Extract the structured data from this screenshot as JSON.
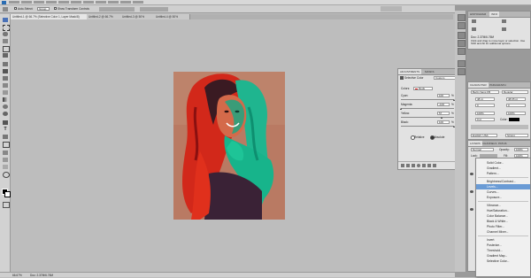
{
  "options_bar": {
    "auto_select_label": "Auto-Select:",
    "auto_select_value": "Group",
    "transform_label": "Show Transform Controls"
  },
  "tabs": [
    {
      "label": "Untitled-1 @ 66.7% (Selective Color 1, Layer Mask/8)"
    },
    {
      "label": "Untitled-2 @ 66.7%"
    },
    {
      "label": "Untitled-3 @ 50%"
    },
    {
      "label": "Untitled-4 @ 50%"
    }
  ],
  "status": {
    "zoom": "66.67%",
    "doc": "Doc: 2.37M/6.76M"
  },
  "adjustments": {
    "tabs": [
      "ADJUSTMENTS",
      "MASKS"
    ],
    "title": "Selective Color",
    "preset": "Custom",
    "colors_label": "Colors:",
    "colors_value": "Reds",
    "rows": [
      {
        "label": "Cyan:",
        "value": "100",
        "pct": "%",
        "level": 1.0
      },
      {
        "label": "Magenta:",
        "value": "-100",
        "pct": "%",
        "level": 0.0
      },
      {
        "label": "Yellow:",
        "value": "57",
        "pct": "%",
        "level": 0.78
      },
      {
        "label": "Black:",
        "value": "100",
        "pct": "%",
        "level": 1.0
      }
    ],
    "relative_label": "Relative",
    "absolute_label": "Absolute",
    "method_selected": "Absolute"
  },
  "info_panel": {
    "tabs": [
      "HISTOGRAM",
      "INFO"
    ],
    "doc": "Doc: 2.37M/6.76M",
    "hint": "Click and drag to move layer or selection. Use Shift and Alt for additional options."
  },
  "character_panel": {
    "tabs": [
      "CHARACTER",
      "PARAGRAPH"
    ],
    "font": "Berlin Sans FB",
    "style": "Regular",
    "size": "48 pt",
    "leading": "48.65 pt",
    "tracking": "0",
    "kerning": "0",
    "scale_v": "100%",
    "scale_h": "100%",
    "baseline": "0 pt",
    "color_label": "Color:",
    "language": "English: USA",
    "aa": "Strong"
  },
  "layers_panel": {
    "tabs": [
      "LAYERS",
      "CHANNELS",
      "PATHS"
    ],
    "blend": "Normal",
    "opacity_label": "Opacity:",
    "opacity": "100%",
    "lock_label": "Lock:",
    "fill_label": "Fill:",
    "fill": "100%"
  },
  "adjustment_menu": {
    "items": [
      "Solid Color...",
      "Gradient...",
      "Pattern...",
      "-",
      "Brightness/Contrast...",
      "Levels...",
      "Curves...",
      "Exposure...",
      "-",
      "Vibrance...",
      "Hue/Saturation...",
      "Color Balance...",
      "Black & White...",
      "Photo Filter...",
      "Channel Mixer...",
      "-",
      "Invert",
      "Posterize...",
      "Threshold...",
      "Gradient Map...",
      "Selective Color..."
    ],
    "highlighted": "Levels..."
  },
  "colors": {
    "highlight": "#6a9bd5",
    "reds_swatch": "#d01010",
    "teal": "#1fb58f",
    "red": "#e0301c"
  }
}
